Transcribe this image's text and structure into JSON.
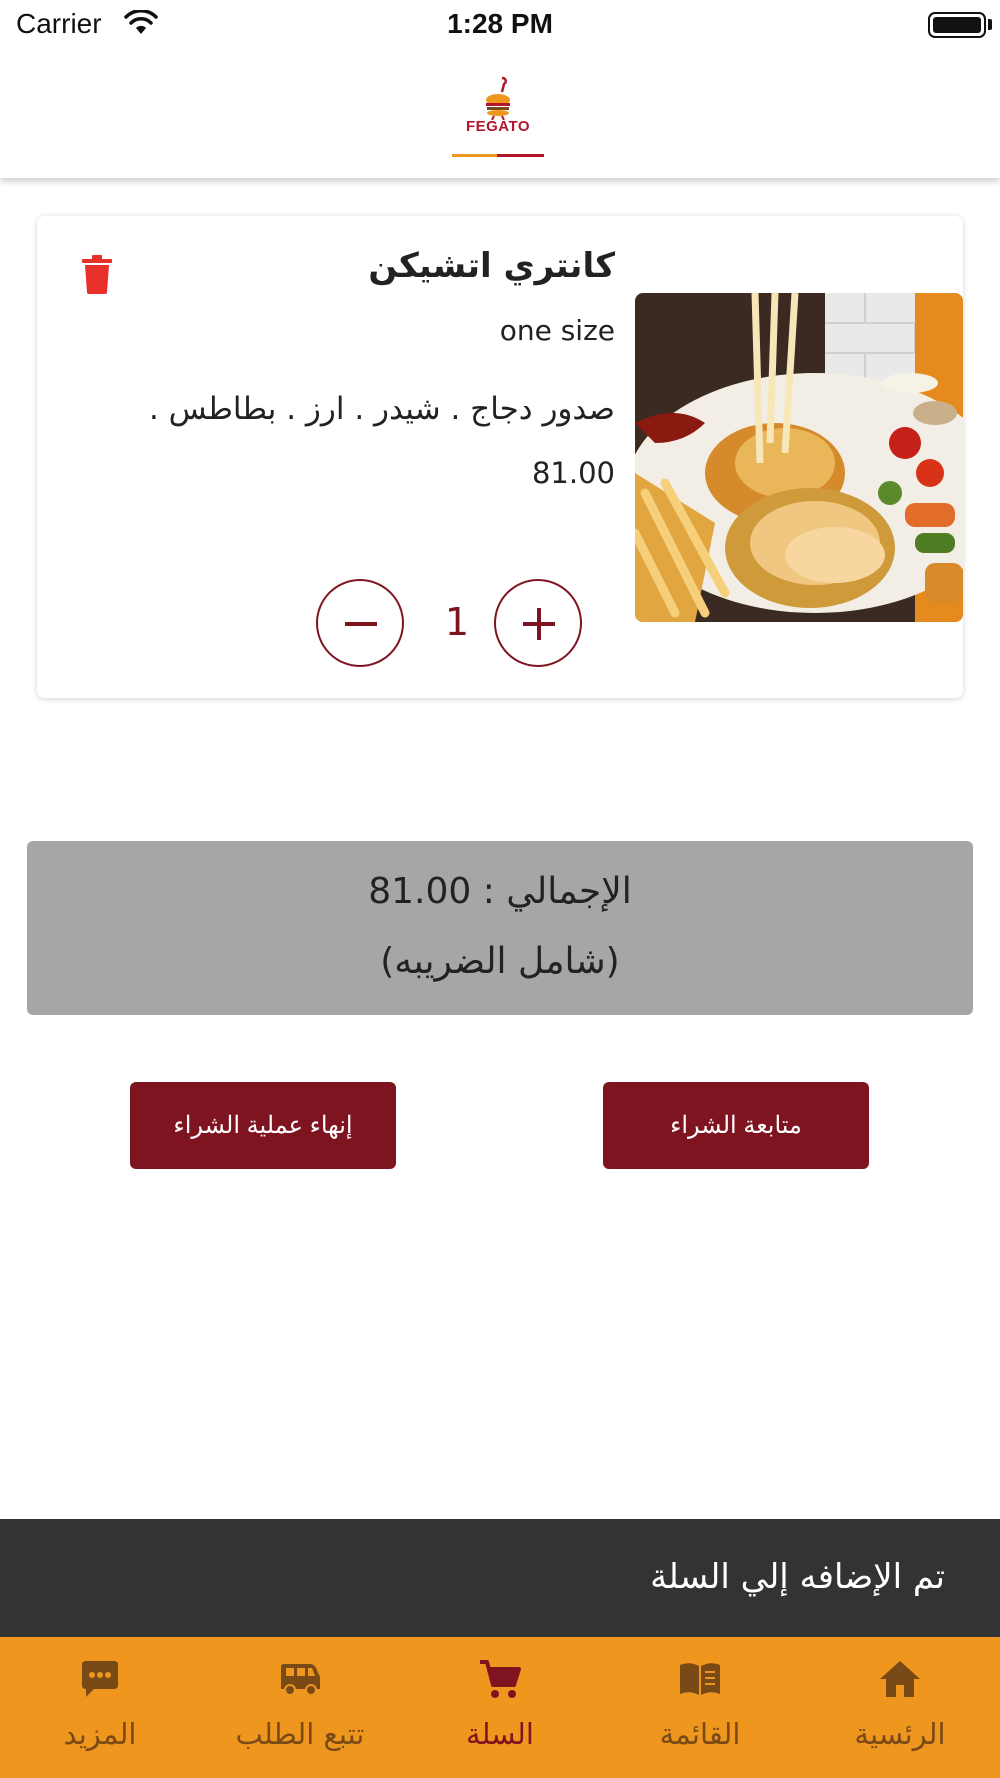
{
  "status_bar": {
    "carrier": "Carrier",
    "time": "1:28 PM"
  },
  "header": {
    "logo_text": "FEGATO",
    "brand_color": "#b2162c",
    "accent_color": "#ee961e"
  },
  "cart": {
    "items": [
      {
        "name": "كانتري اتشيكن",
        "size": "one size",
        "description": "صدور دجاج . شيدر . ارز . بطاطس .",
        "price": "81.00",
        "quantity": "1",
        "image": "food-photo-chicken-cheese-fries"
      }
    ]
  },
  "total": {
    "label": "الإجمالي : 81.00",
    "tax_note": "(شامل الضريبه)"
  },
  "actions": {
    "finish_label": "إنهاء عملية الشراء",
    "continue_label": "متابعة الشراء",
    "button_color": "#7f1421"
  },
  "toast": {
    "message": "تم الإضافه إلي السلة"
  },
  "tab_bar": {
    "active": "cart",
    "items": [
      {
        "id": "more",
        "label": "المزيد",
        "icon": "more-chat-icon"
      },
      {
        "id": "track",
        "label": "تتبع الطلب",
        "icon": "delivery-van-icon"
      },
      {
        "id": "cart",
        "label": "السلة",
        "icon": "cart-icon"
      },
      {
        "id": "menu",
        "label": "القائمة",
        "icon": "book-icon"
      },
      {
        "id": "home",
        "label": "الرئسية",
        "icon": "home-icon"
      }
    ]
  }
}
